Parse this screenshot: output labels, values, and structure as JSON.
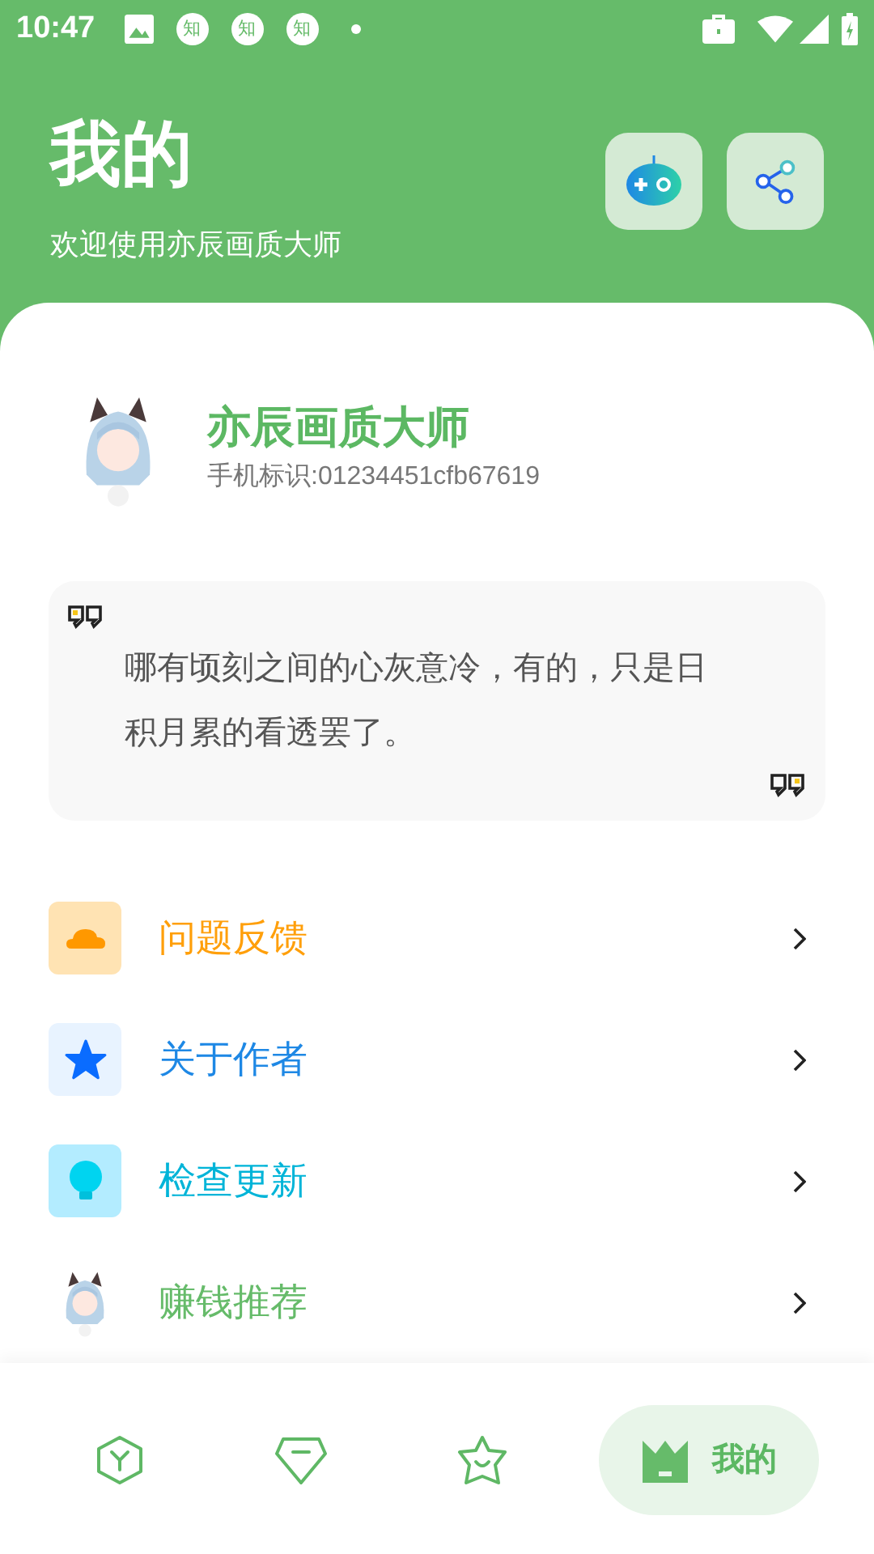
{
  "status_bar": {
    "time": "10:47",
    "notifications": [
      "知",
      "知",
      "知"
    ]
  },
  "header": {
    "title": "我的",
    "subtitle": "欢迎使用亦辰画质大师"
  },
  "profile": {
    "name": "亦辰画质大师",
    "device_id": "手机标识:01234451cfb67619"
  },
  "quote": {
    "text": "哪有顷刻之间的心灰意冷，有的，只是日积月累的看透罢了。"
  },
  "menu": [
    {
      "label": "问题反馈",
      "kind": "cloud",
      "color": "#ff9f0a"
    },
    {
      "label": "关于作者",
      "kind": "star",
      "color": "#1e88e5"
    },
    {
      "label": "检查更新",
      "kind": "bulb",
      "color": "#00b4d8"
    },
    {
      "label": "赚钱推荐",
      "kind": "picture",
      "color": "#66bb6a"
    }
  ],
  "nav": [
    {
      "kind": "hexagon",
      "selected": false
    },
    {
      "kind": "gem",
      "selected": false
    },
    {
      "kind": "star",
      "selected": false
    },
    {
      "kind": "crown",
      "selected": true,
      "label": "我的"
    }
  ]
}
